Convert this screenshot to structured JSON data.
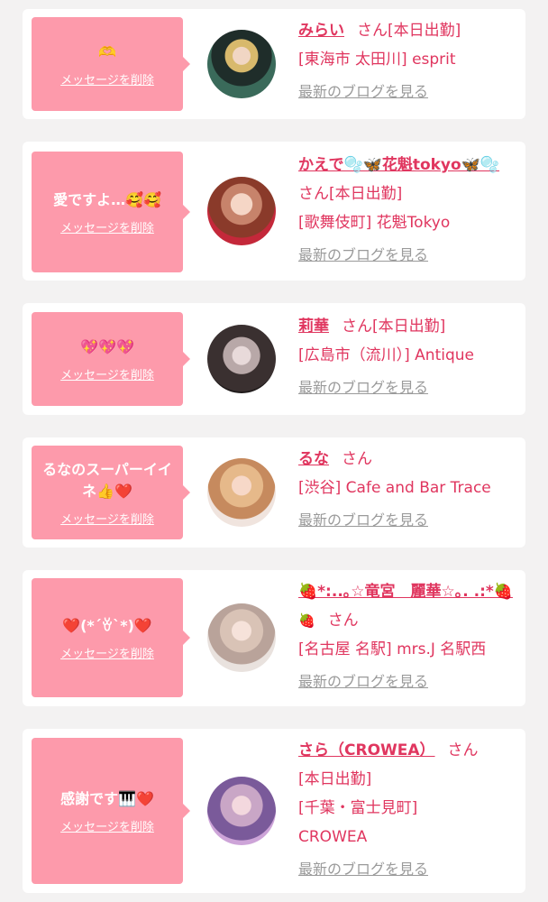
{
  "colors": {
    "accent": "#e0365f",
    "bubble": "#fd9aab",
    "link_gray": "#9a9a9a"
  },
  "delete_label": "メッセージを削除",
  "blog_label": "最新のブログを見る",
  "san_label": "さん",
  "cards": [
    {
      "message": "🫶",
      "name": "みらい",
      "status": "[本日出勤]",
      "shop": "[東海市 太田川] esprit"
    },
    {
      "message": "愛ですよ…🥰🥰",
      "name": "かえで🫧🦋花魁tokyo🦋🫧",
      "status": "[本日出勤]",
      "shop": "[歌舞伎町] 花魁Tokyo"
    },
    {
      "message": "💖💖💖",
      "name": "莉華",
      "status": "[本日出勤]",
      "shop": "[広島市（流川）] Antique"
    },
    {
      "message": "るなのスーパーイイネ👍❤️",
      "name": "るな",
      "status": "",
      "shop": "[渋谷] Cafe and Bar Trace"
    },
    {
      "message": "❤️(*´ꈊ`*)❤️",
      "name": "🍓*:..｡☆竜宮　麗華☆｡. .:*🍓",
      "status": "",
      "shop": "[名古屋 名駅] mrs.J 名駅西"
    },
    {
      "message": "感謝です🎹❤️",
      "name": "さら（CROWEA）",
      "status": "[本日出勤]",
      "shop": "[千葉・富士見町] CROWEA"
    }
  ]
}
